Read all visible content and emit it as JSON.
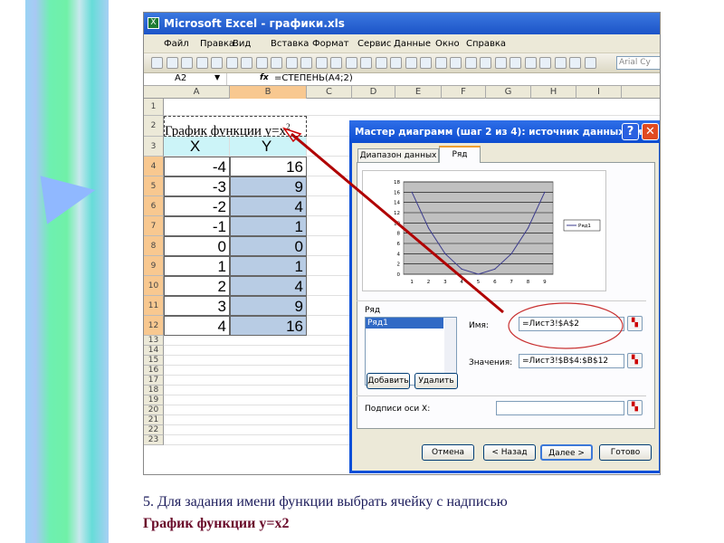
{
  "excel": {
    "title": "Microsoft Excel - графики.xls",
    "menu": [
      "Файл",
      "Правка",
      "Вид",
      "Вставка",
      "Формат",
      "Сервис",
      "Данные",
      "Окно",
      "Справка"
    ],
    "font_box": "Arial Cy",
    "name_box": "A2",
    "fx": "fx",
    "formula": "=СТЕПЕНЬ(A4;2)",
    "columns": [
      "A",
      "B",
      "C",
      "D",
      "E",
      "F",
      "G",
      "H",
      "I"
    ],
    "rows": [
      "1",
      "2",
      "3",
      "4",
      "5",
      "6",
      "7",
      "8",
      "9",
      "10",
      "11",
      "12",
      "13",
      "14",
      "15",
      "16",
      "17",
      "18",
      "19",
      "20",
      "21",
      "22",
      "23"
    ],
    "title_cell": "График  функции y=x",
    "title_sup": "2",
    "hdr_x": "X",
    "hdr_y": "Y",
    "x_values": [
      "-4",
      "-3",
      "-2",
      "-1",
      "0",
      "1",
      "2",
      "3",
      "4"
    ],
    "y_values": [
      "16",
      "9",
      "4",
      "1",
      "0",
      "1",
      "4",
      "9",
      "16"
    ]
  },
  "dialog": {
    "title": "Мастер диаграмм (шаг 2 из 4): источник данных диа...",
    "help": "?",
    "close": "✕",
    "tabs": [
      "Диапазон данных",
      "Ряд"
    ],
    "series_label": "Ряд",
    "series_list": [
      "Ряд1"
    ],
    "add": "Добавить",
    "remove": "Удалить",
    "name_label": "Имя:",
    "name_value": "=Лист3!$A$2",
    "values_label": "Значения:",
    "values_value": "=Лист3!$B$4:$B$12",
    "xlabels_label": "Подписи оси X:",
    "xlabels_value": "",
    "buttons": [
      "Отмена",
      "< Назад",
      "Далее >",
      "Готово"
    ]
  },
  "chart_data": {
    "type": "line",
    "x": [
      1,
      2,
      3,
      4,
      5,
      6,
      7,
      8,
      9
    ],
    "series": [
      {
        "name": "Ряд1",
        "values": [
          16,
          9,
          4,
          1,
          0,
          1,
          4,
          9,
          16
        ]
      }
    ],
    "yticks": [
      0,
      2,
      4,
      6,
      8,
      10,
      12,
      14,
      16,
      18
    ],
    "xticks": [
      "1",
      "2",
      "3",
      "4",
      "5",
      "6",
      "7",
      "8",
      "9"
    ],
    "ylim": [
      0,
      18
    ],
    "legend": "right",
    "grid": true,
    "colors": {
      "line": "#3a3a8c",
      "plot_bg": "#c0c0c0"
    }
  },
  "caption": {
    "line1": "5. Для задания имени функции выбрать ячейку с надписью",
    "line2": "График функции y=x2"
  }
}
